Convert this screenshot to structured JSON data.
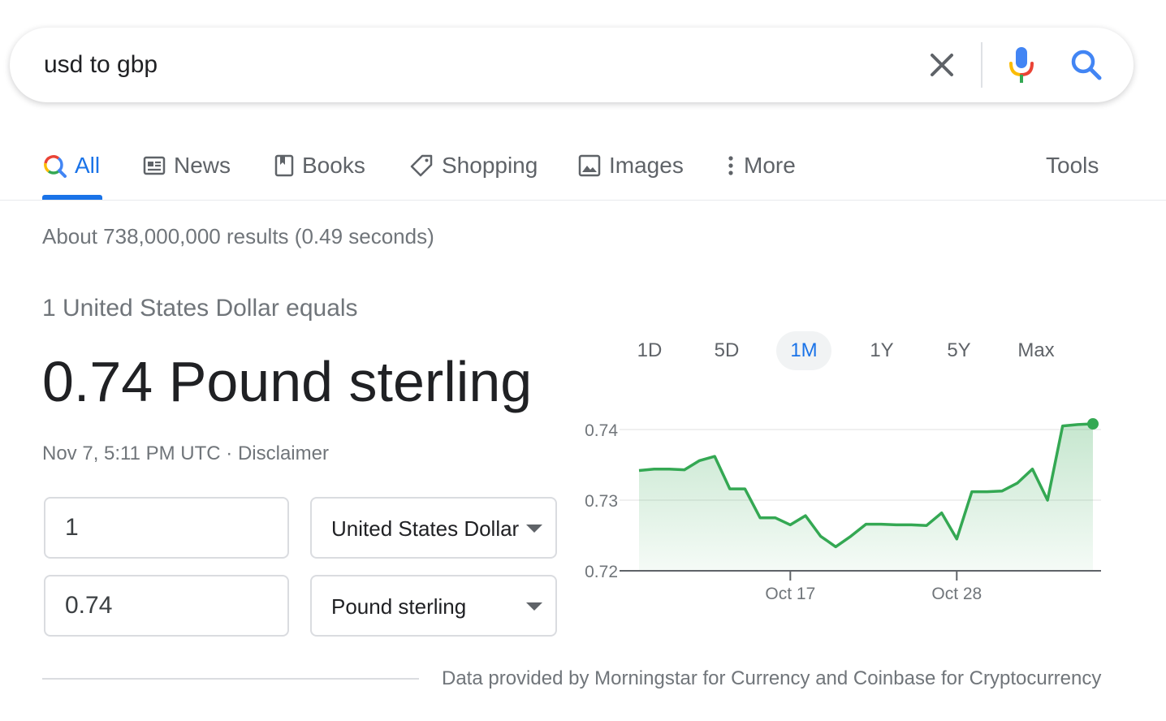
{
  "search": {
    "query": "usd to gbp"
  },
  "tabs": [
    {
      "label": "All",
      "icon": "search-icon"
    },
    {
      "label": "News",
      "icon": "news-icon"
    },
    {
      "label": "Books",
      "icon": "book-icon"
    },
    {
      "label": "Shopping",
      "icon": "tag-icon"
    },
    {
      "label": "Images",
      "icon": "image-icon"
    },
    {
      "label": "More",
      "icon": "more-vert-icon"
    }
  ],
  "tools_label": "Tools",
  "result_stats": "About 738,000,000 results (0.49 seconds)",
  "converter": {
    "equals_text": "1 United States Dollar equals",
    "result_text": "0.74 Pound sterling",
    "timestamp": "Nov 7, 5:11 PM UTC",
    "separator": " · ",
    "disclaimer": "Disclaimer",
    "from_amount": "1",
    "from_currency": "United States Dollar",
    "to_amount": "0.74",
    "to_currency": "Pound sterling"
  },
  "range_tabs": [
    "1D",
    "5D",
    "1M",
    "1Y",
    "5Y",
    "Max"
  ],
  "active_range": "1M",
  "colors": {
    "accent": "#1a73e8",
    "line": "#34a853",
    "text_secondary": "#70757a"
  },
  "chart_data": {
    "type": "area",
    "ylim": [
      0.72,
      0.74
    ],
    "yticks": [
      "0.74",
      "0.73",
      "0.72"
    ],
    "ytick_values": [
      0.74,
      0.73,
      0.72
    ],
    "xticks": [
      {
        "label": "Oct 17",
        "index": 10
      },
      {
        "label": "Oct 28",
        "index": 21
      }
    ],
    "values": [
      0.7342,
      0.7344,
      0.7344,
      0.7343,
      0.7356,
      0.7362,
      0.7316,
      0.7316,
      0.7275,
      0.7275,
      0.7265,
      0.7278,
      0.7249,
      0.7234,
      0.7249,
      0.7266,
      0.7266,
      0.7265,
      0.7265,
      0.7264,
      0.7282,
      0.7245,
      0.7312,
      0.7312,
      0.7313,
      0.7324,
      0.7344,
      0.73,
      0.7405,
      0.7407,
      0.7408
    ],
    "grid": true
  },
  "source_note": "Data provided by Morningstar for Currency and Coinbase for Cryptocurrency"
}
